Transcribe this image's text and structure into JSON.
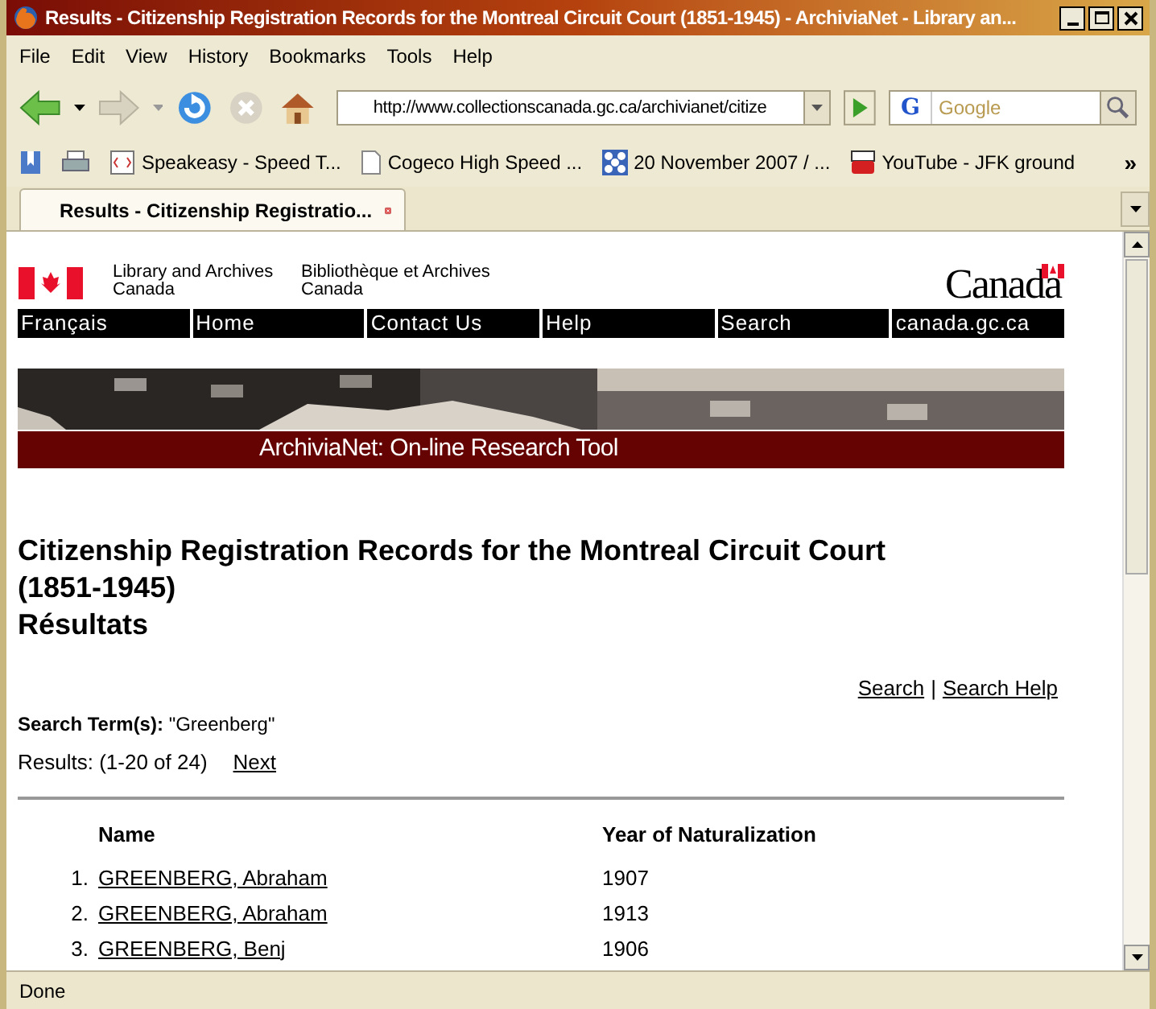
{
  "window": {
    "title": "Results - Citizenship Registration Records for the Montreal Circuit Court (1851-1945) - ArchiviaNet - Library an..."
  },
  "menu": [
    "File",
    "Edit",
    "View",
    "History",
    "Bookmarks",
    "Tools",
    "Help"
  ],
  "toolbar": {
    "url": "http://www.collectionscanada.gc.ca/archivianet/citize",
    "search_placeholder": "Google",
    "search_engine": "G"
  },
  "bookmarks": [
    {
      "label": "Speakeasy - Speed T...",
      "kind": "code"
    },
    {
      "label": "Cogeco High Speed ...",
      "kind": "page"
    },
    {
      "label": "20 November 2007 / ...",
      "kind": "pattern"
    },
    {
      "label": "YouTube - JFK ground",
      "kind": "youtube"
    }
  ],
  "bookmarks_more": "»",
  "tabs": [
    {
      "label": "Results - Citizenship Registratio...",
      "selected": true
    }
  ],
  "page": {
    "agency_en": [
      "Library and Archives",
      "Canada"
    ],
    "agency_fr": [
      "Bibliothèque et Archives",
      "Canada"
    ],
    "wordmark": "Canada",
    "nav": [
      "Français",
      "Home",
      "Contact Us",
      "Help",
      "Search",
      "canada.gc.ca"
    ],
    "banner_title": "ArchiviaNet: On-line Research Tool",
    "heading": "Citizenship Registration Records for the Montreal Circuit Court (1851-1945)",
    "subheading": "Résultats",
    "links": [
      "Search",
      "Search Help"
    ],
    "link_separator": "|",
    "search_term_label": "Search Term(s):",
    "search_term": "\"Greenberg\"",
    "results": "Results: (1-20 of 24)",
    "next": "Next",
    "table": {
      "columns": [
        "Name",
        "Year of Naturalization"
      ],
      "rows": [
        {
          "number": "1.",
          "name": "GREENBERG, Abraham",
          "year": "1907"
        },
        {
          "number": "2.",
          "name": "GREENBERG, Abraham",
          "year": "1913"
        },
        {
          "number": "3.",
          "name": "GREENBERG, Benj",
          "year": "1906"
        }
      ]
    }
  },
  "status_bar": "Done"
}
